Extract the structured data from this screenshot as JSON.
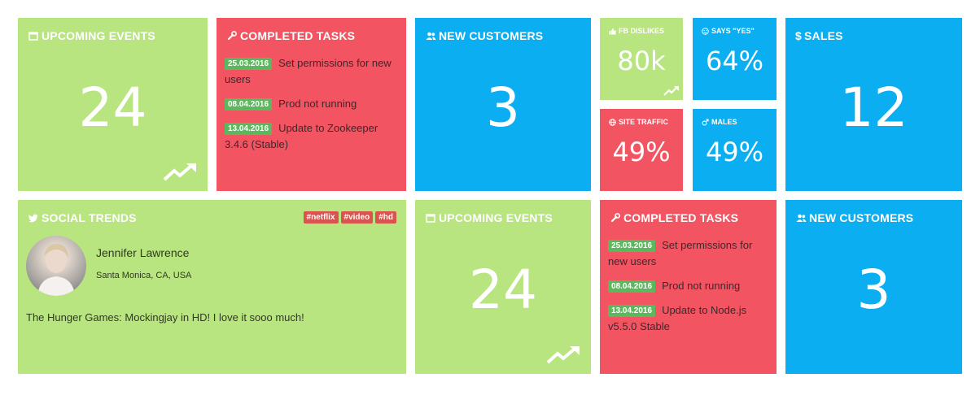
{
  "tiles": {
    "upcoming1": {
      "title": "Upcoming Events",
      "value": "24",
      "icon": "calendar-icon"
    },
    "completed1": {
      "title": "Completed Tasks",
      "icon": "wrench-icon",
      "tasks": [
        {
          "date": "25.03.2016",
          "text": "Set permissions for new users"
        },
        {
          "date": "08.04.2016",
          "text": "Prod not running"
        },
        {
          "date": "13.04.2016",
          "text": "Update to Zookeeper 3.4.6 (Stable)"
        }
      ]
    },
    "customers1": {
      "title": "New Customers",
      "value": "3",
      "icon": "users-icon"
    },
    "fb": {
      "title": "FB Dislikes",
      "value": "80k",
      "icon": "thumbs-up-icon"
    },
    "yes": {
      "title": "Says \"Yes\"",
      "value": "64%",
      "icon": "smile-icon"
    },
    "sales": {
      "title": "Sales",
      "value": "12",
      "icon": "dollar-icon"
    },
    "traffic": {
      "title": "Site Traffic",
      "value": "49%",
      "icon": "globe-icon"
    },
    "males": {
      "title": "Males",
      "value": "49%",
      "icon": "male-icon"
    },
    "social": {
      "title": "Social Trends",
      "icon": "twitter-icon",
      "tags": [
        "#netflix",
        "#video",
        "#hd"
      ],
      "name": "Jennifer Lawrence",
      "location": "Santa Monica, CA, USA",
      "tweet": "The Hunger Games: Mockingjay in HD! I love it sooo much!"
    },
    "upcoming2": {
      "title": "Upcoming Events",
      "value": "24",
      "icon": "calendar-icon"
    },
    "completed2": {
      "title": "Completed Tasks",
      "icon": "wrench-icon",
      "tasks": [
        {
          "date": "25.03.2016",
          "text": "Set permissions for new users"
        },
        {
          "date": "08.04.2016",
          "text": "Prod not running"
        },
        {
          "date": "13.04.2016",
          "text": "Update to Node.js v5.5.0 Stable"
        }
      ]
    },
    "customers2": {
      "title": "New Customers",
      "value": "3",
      "icon": "users-icon"
    }
  },
  "colors": {
    "green": "#b8e57f",
    "red": "#f25462",
    "blue": "#0aaef1",
    "badge": "#5cb85c",
    "tag": "#d9534f"
  }
}
